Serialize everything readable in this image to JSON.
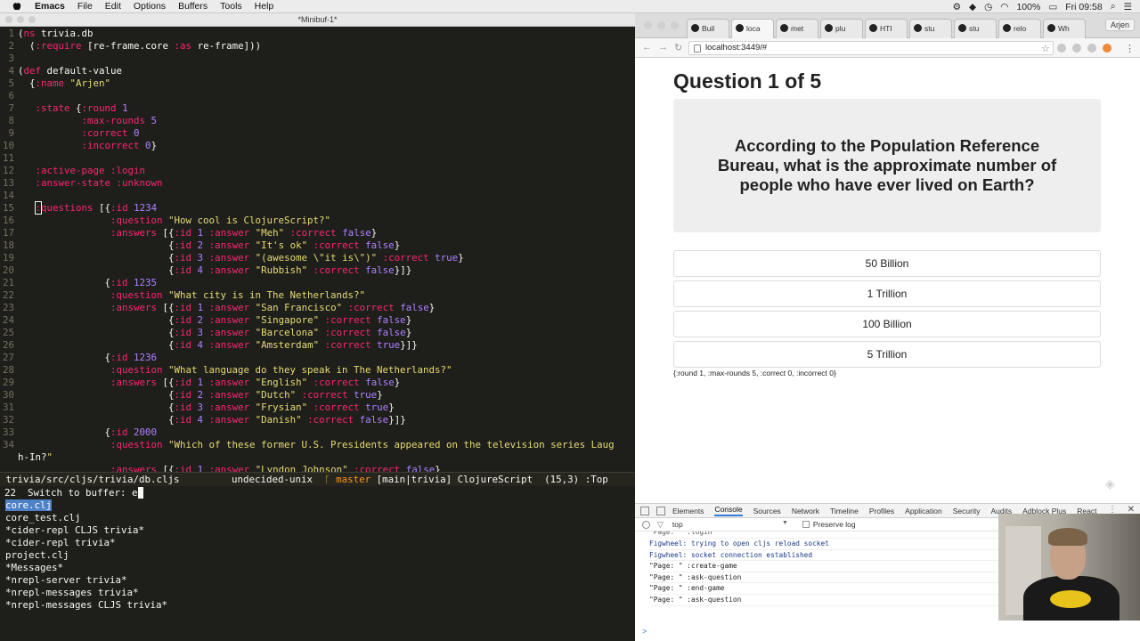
{
  "menubar": {
    "app_name": "Emacs",
    "items": [
      "File",
      "Edit",
      "Options",
      "Buffers",
      "Tools",
      "Help"
    ],
    "battery": "100%",
    "clock": "Fri 09:58"
  },
  "emacs": {
    "window_title": "*Minibuf-1*",
    "code_lines": [
      {
        "n": "1",
        "t": "(ns trivia.db"
      },
      {
        "n": "2",
        "t": "  (:require [re-frame.core :as re-frame]))"
      },
      {
        "n": "3",
        "t": ""
      },
      {
        "n": "4",
        "t": "(def default-value"
      },
      {
        "n": "5",
        "t": "  {:name \"Arjen\""
      },
      {
        "n": "6",
        "t": ""
      },
      {
        "n": "7",
        "t": "   :state {:round 1"
      },
      {
        "n": "8",
        "t": "           :max-rounds 5"
      },
      {
        "n": "9",
        "t": "           :correct 0"
      },
      {
        "n": "10",
        "t": "           :incorrect 0}"
      },
      {
        "n": "11",
        "t": ""
      },
      {
        "n": "12",
        "t": "   :active-page :login"
      },
      {
        "n": "13",
        "t": "   :answer-state :unknown"
      },
      {
        "n": "14",
        "t": ""
      },
      {
        "n": "15",
        "t": "   :questions [{:id 1234"
      },
      {
        "n": "16",
        "t": "                :question \"How cool is ClojureScript?\""
      },
      {
        "n": "17",
        "t": "                :answers [{:id 1 :answer \"Meh\" :correct false}"
      },
      {
        "n": "18",
        "t": "                          {:id 2 :answer \"It's ok\" :correct false}"
      },
      {
        "n": "19",
        "t": "                          {:id 3 :answer \"(awesome \\\"it is\\\")\" :correct true}"
      },
      {
        "n": "20",
        "t": "                          {:id 4 :answer \"Rubbish\" :correct false}]}"
      },
      {
        "n": "21",
        "t": "               {:id 1235"
      },
      {
        "n": "22",
        "t": "                :question \"What city is in The Netherlands?\""
      },
      {
        "n": "23",
        "t": "                :answers [{:id 1 :answer \"San Francisco\" :correct false}"
      },
      {
        "n": "24",
        "t": "                          {:id 2 :answer \"Singapore\" :correct false}"
      },
      {
        "n": "25",
        "t": "                          {:id 3 :answer \"Barcelona\" :correct false}"
      },
      {
        "n": "26",
        "t": "                          {:id 4 :answer \"Amsterdam\" :correct true}]}"
      },
      {
        "n": "27",
        "t": "               {:id 1236"
      },
      {
        "n": "28",
        "t": "                :question \"What language do they speak in The Netherlands?\""
      },
      {
        "n": "29",
        "t": "                :answers [{:id 1 :answer \"English\" :correct false}"
      },
      {
        "n": "30",
        "t": "                          {:id 2 :answer \"Dutch\" :correct true}"
      },
      {
        "n": "31",
        "t": "                          {:id 3 :answer \"Frysian\" :correct true}"
      },
      {
        "n": "32",
        "t": "                          {:id 4 :answer \"Danish\" :correct false}]}"
      },
      {
        "n": "33",
        "t": "               {:id 2000"
      },
      {
        "n": "34",
        "t": "                :question \"Which of these former U.S. Presidents appeared on the television series Laug"
      },
      {
        "n": "",
        "t": "h-In?\""
      },
      {
        "n": "",
        "t": "                :answers [{:id 1 :answer \"Lyndon Johnson\" :correct false}"
      }
    ],
    "modeline": {
      "file": "trivia/src/cljs/trivia/db.cljs",
      "status": "undecided-unix",
      "branch_icon": "branch-icon",
      "branch": "master",
      "project": "[main|trivia]",
      "mode": "ClojureScript",
      "position": "(15,3)",
      "scroll": ":Top"
    },
    "minibuffer": {
      "count": "22",
      "prompt": "Switch to buffer: ",
      "input": "e",
      "buffers": [
        "core.clj",
        "core_test.clj",
        "*cider-repl CLJS trivia*",
        "*cider-repl trivia*",
        "project.clj",
        "*Messages*",
        "*nrepl-server trivia*",
        "*nrepl-messages trivia*",
        "*nrepl-messages CLJS trivia*"
      ]
    }
  },
  "browser": {
    "tabs": [
      "Buil",
      "loca",
      "met",
      "plu",
      "HTI",
      "stu",
      "stu",
      "relo",
      "Wh"
    ],
    "profile": "Arjen",
    "url": "localhost:3449/#",
    "page": {
      "heading": "Question 1 of 5",
      "question": "According to the Population Reference Bureau, what is the approximate number of people who have ever lived on Earth?",
      "answers": [
        "50 Billion",
        "1 Trillion",
        "100 Billion",
        "5 Trillion"
      ],
      "state": "{:round 1, :max-rounds 5, :correct 0, :incorrect 0}"
    },
    "devtools": {
      "tabs": [
        "Elements",
        "Console",
        "Sources",
        "Network",
        "Timeline",
        "Profiles",
        "Application",
        "Security",
        "Audits",
        "Adblock Plus",
        "React"
      ],
      "active_tab": "Console",
      "context": "top",
      "preserve_log": "Preserve log",
      "console_lines": [
        {
          "text": "\"Page: \" :login",
          "fig": false,
          "cut": true
        },
        {
          "text": "Figwheel: trying to open cljs reload socket",
          "fig": true
        },
        {
          "text": "Figwheel: socket connection established",
          "fig": true
        },
        {
          "text": "\"Page: \" :create-game",
          "fig": false
        },
        {
          "text": "\"Page: \" :ask-question",
          "fig": false
        },
        {
          "text": "\"Page: \" :end-game",
          "fig": false
        },
        {
          "text": "\"Page: \" :ask-question",
          "fig": false
        }
      ],
      "prompt": ">"
    }
  }
}
